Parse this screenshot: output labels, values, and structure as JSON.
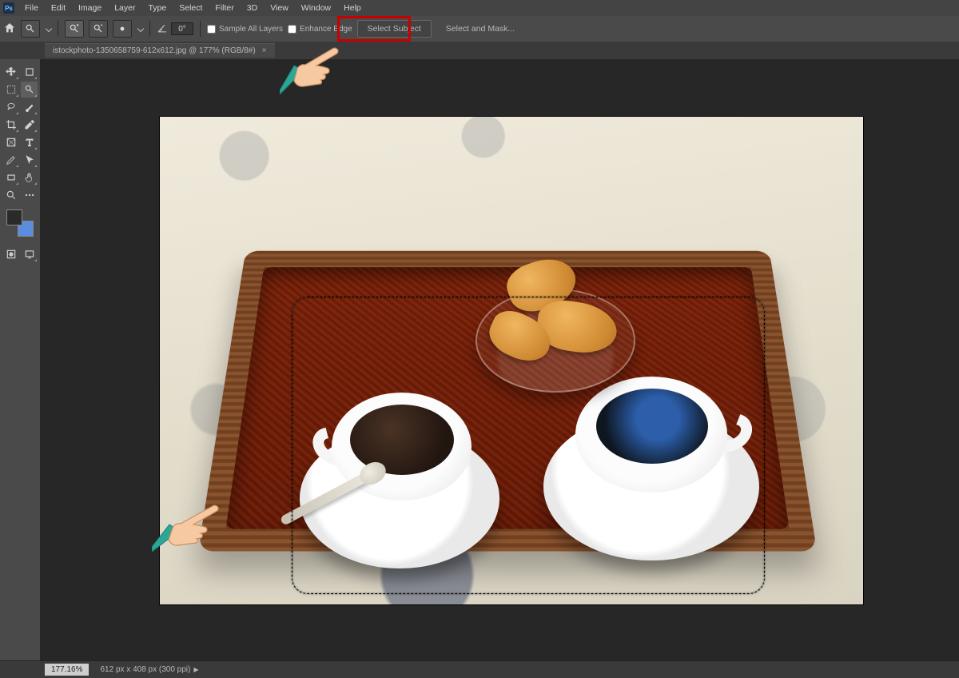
{
  "app": {
    "icon_label": "Ps"
  },
  "menubar": [
    "File",
    "Edit",
    "Image",
    "Layer",
    "Type",
    "Select",
    "Filter",
    "3D",
    "View",
    "Window",
    "Help"
  ],
  "optionsbar": {
    "angle_value": "0°",
    "sample_all_layers": "Sample All Layers",
    "enhance_edge": "Enhance Edge",
    "select_subject": "Select Subject",
    "select_and_mask": "Select and Mask..."
  },
  "document": {
    "tab_label": "istockphoto-1350658759-612x612.jpg @ 177% (RGB/8#)"
  },
  "statusbar": {
    "zoom": "177.16%",
    "doc_dims": "612 px x 408 px (300 ppi)"
  },
  "toolbox": {
    "rows": [
      [
        "move-tool",
        "artboard-tool"
      ],
      [
        "marquee-tool",
        "quick-selection-tool"
      ],
      [
        "lasso-tool",
        "brush-tool"
      ],
      [
        "crop-tool",
        "eyedropper-tool"
      ],
      [
        "frame-tool",
        "type-tool"
      ],
      [
        "pen-tool",
        "path-selection-tool"
      ],
      [
        "rectangle-tool",
        "hand-tool"
      ],
      [
        "zoom-tool",
        "edit-toolbar"
      ]
    ]
  },
  "annotations": {
    "highlight_target": "select-subject-button"
  }
}
